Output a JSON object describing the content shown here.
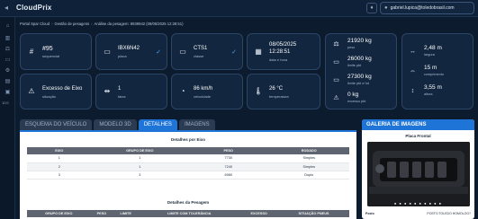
{
  "app": {
    "title": "CloudPrix"
  },
  "header": {
    "user_email": "gabriel.lupica@toledobrasil.com"
  },
  "sidebar": {
    "items": [
      {
        "icon": "home-icon"
      },
      {
        "icon": "chart-icon"
      },
      {
        "icon": "scale-icon"
      },
      {
        "icon": "truck-icon"
      },
      {
        "icon": "gear-icon"
      },
      {
        "icon": "report-icon"
      },
      {
        "icon": "monitor-icon"
      }
    ],
    "footer_label": "1DS"
  },
  "breadcrumb": [
    "Portal Spar Cloud",
    "Gestão de pesagens",
    "Análise da pesagem: 8939942 (08/05/2025 12:28:51)"
  ],
  "cards_row1": [
    {
      "icon": "hash-icon",
      "value": "#95",
      "label": "sequencial",
      "check": false
    },
    {
      "icon": "card-icon",
      "value": "IBX6N42",
      "label": "placa",
      "check": true
    },
    {
      "icon": "card-icon",
      "value": "CTS1",
      "label": "classe",
      "check": true
    },
    {
      "icon": "calendar-icon",
      "value": "08/05/2025",
      "value2": "12:28:51",
      "label": "data e hora",
      "check": false
    }
  ],
  "cards_row2": [
    {
      "icon": "alert-icon",
      "value": "Excesso de Eixo",
      "label": "situação"
    },
    {
      "icon": "axle-icon",
      "value": "1",
      "label": "faixa"
    },
    {
      "icon": "speed-icon",
      "value": "86 km/h",
      "label": "velocidade"
    },
    {
      "icon": "thermometer-icon",
      "value": "26 °C",
      "label": "temperatura"
    }
  ],
  "weights": [
    {
      "value": "21920 kg",
      "label": "peso"
    },
    {
      "value": "26000 kg",
      "label": "limite pbt"
    },
    {
      "value": "27300 kg",
      "label": "limite pbt c/ tol"
    },
    {
      "value": "0 kg",
      "label": "excesso pbt"
    }
  ],
  "dimensions": [
    {
      "value": "2,48 m",
      "label": "largura"
    },
    {
      "value": "15 m",
      "label": "comprimento"
    },
    {
      "value": "3,55 m",
      "label": "altura"
    }
  ],
  "tabs": [
    {
      "label": "ESQUEMA DO VEÍCULO",
      "active": false
    },
    {
      "label": "MODELO 3D",
      "active": false
    },
    {
      "label": "DETALHES",
      "active": true
    },
    {
      "label": "IMAGENS",
      "active": false
    }
  ],
  "details": {
    "axle_title": "Detalhes por Eixo",
    "axle_headers": [
      "EIXO",
      "GRUPO DE EIXO",
      "PESO",
      "RODADO"
    ],
    "axle_rows": [
      [
        "1",
        "1",
        "7730",
        "Simples"
      ],
      [
        "2",
        "1",
        "7240",
        "Simples"
      ],
      [
        "3",
        "3",
        "6980",
        "Duplo"
      ]
    ],
    "weigh_title": "Detalhes da Pesagem",
    "weigh_headers": [
      "GRUPO DE EIXO",
      "PESO",
      "LIMITE",
      "LIMITE COM TOLERÂNCIA",
      "EXCESSO",
      "SITUAÇÃO PNEUS"
    ]
  },
  "gallery": {
    "title": "GALERIA DE IMAGENS",
    "subtitle": "Placa Frontal",
    "footer_left": "Posto",
    "footer_right": "POSTO TOLEDO HOMOLOG?"
  },
  "colors": {
    "accent": "#1f74d8",
    "background": "#0d1b2e",
    "card": "#12263f"
  }
}
